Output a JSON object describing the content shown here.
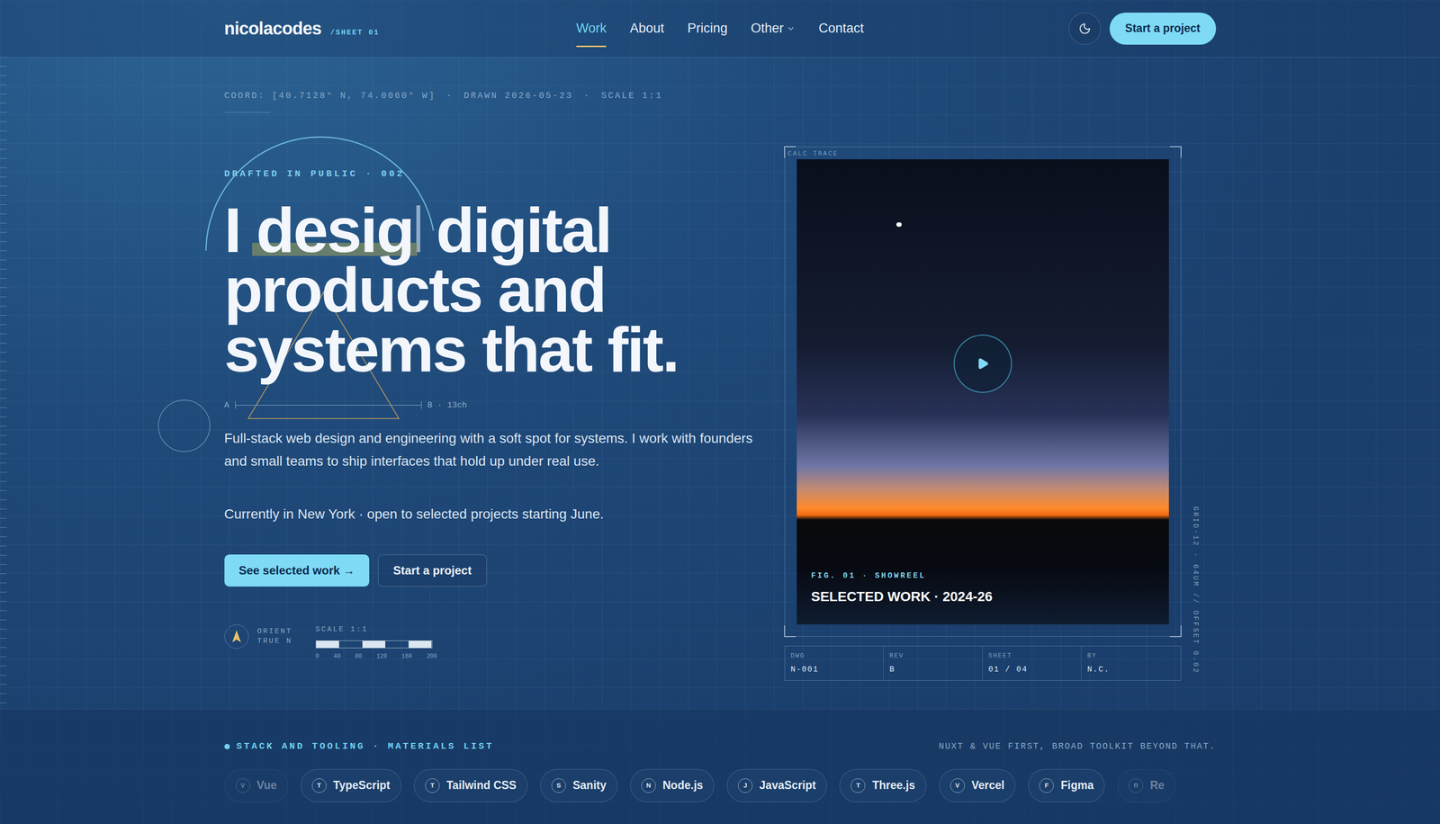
{
  "nav": {
    "logo": "nicolacodes",
    "sheet": "/SHEET 01",
    "links": [
      {
        "label": "Work",
        "selected": true,
        "has_menu": false
      },
      {
        "label": "About",
        "selected": false,
        "has_menu": false
      },
      {
        "label": "Pricing",
        "selected": false,
        "has_menu": false
      },
      {
        "label": "Other",
        "selected": false,
        "has_menu": true
      },
      {
        "label": "Contact",
        "selected": false,
        "has_menu": false
      }
    ],
    "cta": "Start a project"
  },
  "meta": {
    "items": [
      "COORD: [40.7128° N, 74.0060° W]",
      "DRAWN 2026-05-23",
      "SCALE 1:1"
    ],
    "separator": "·"
  },
  "hero": {
    "eyebrow": "DRAFTED IN PUBLIC · 002",
    "headline": {
      "lead": "I",
      "typed": "desig",
      "first_line_rest": "digital",
      "lines": [
        "products and",
        "systems that fit."
      ]
    },
    "measure": {
      "start": "A",
      "end": "B · 13ch"
    },
    "paragraphs": [
      "Full-stack web design and engineering with a soft spot for systems. I work with founders and small teams to ship interfaces that hold up under real use.",
      "Currently in New York · open to selected projects starting June."
    ],
    "buttons": [
      {
        "label": "See selected work →",
        "primary": true
      },
      {
        "label": "Start a project",
        "primary": false
      }
    ],
    "orient": [
      "ORIENT",
      "TRUE N"
    ],
    "scale": {
      "label": "SCALE 1:1",
      "ticks": [
        "0",
        "40",
        "80",
        "120",
        "160",
        "200"
      ]
    }
  },
  "showreel": {
    "trace_label": "CALC TRACE",
    "figure": "FIG. 01 · SHOWREEL",
    "title": "SELECTED WORK · 2024-26",
    "side_note": "GRID-12 · 64UM // OFFSET 0.02",
    "title_block": [
      {
        "label": "DWG",
        "value": "N-001"
      },
      {
        "label": "REV",
        "value": "B"
      },
      {
        "label": "SHEET",
        "value": "01 / 04"
      },
      {
        "label": "BY",
        "value": "N.C."
      }
    ]
  },
  "stack": {
    "heading": "STACK AND TOOLING · MATERIALS LIST",
    "note": "NUXT & VUE FIRST, BROAD TOOLKIT BEYOND THAT.",
    "items": [
      {
        "label": "Vue",
        "initial": "V",
        "faded": true
      },
      {
        "label": "TypeScript",
        "initial": "T",
        "faded": false
      },
      {
        "label": "Tailwind CSS",
        "initial": "T",
        "faded": false
      },
      {
        "label": "Sanity",
        "initial": "S",
        "faded": false
      },
      {
        "label": "Node.js",
        "initial": "N",
        "faded": false
      },
      {
        "label": "JavaScript",
        "initial": "J",
        "faded": false
      },
      {
        "label": "Three.js",
        "initial": "T",
        "faded": false
      },
      {
        "label": "Vercel",
        "initial": "V",
        "faded": false
      },
      {
        "label": "Figma",
        "initial": "F",
        "faded": false
      },
      {
        "label": "Re",
        "initial": "R",
        "faded": true
      }
    ]
  }
}
